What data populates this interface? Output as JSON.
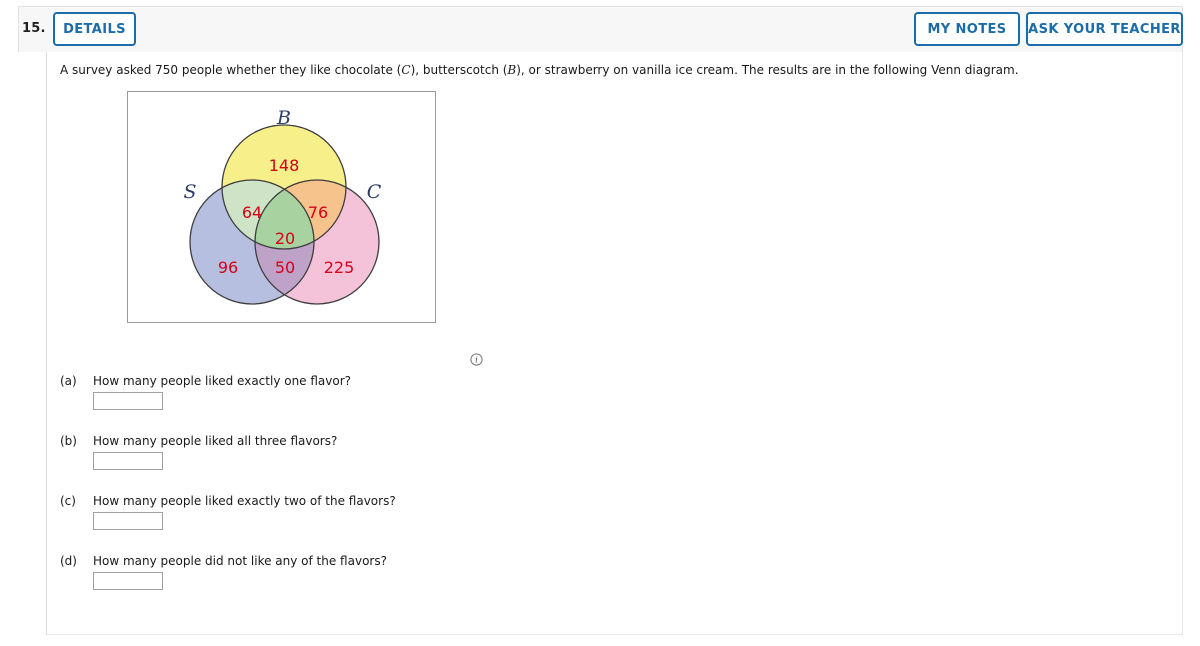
{
  "header": {
    "question_number": "15.",
    "details_label": "DETAILS",
    "my_notes_label": "MY NOTES",
    "ask_teacher_label": "ASK YOUR TEACHER",
    "accent_color": "#1b6ca8",
    "bar_background": "#f7f7f7"
  },
  "prompt": {
    "text_part_1": "A survey asked 750 people whether they like chocolate (",
    "var_c": "C",
    "text_part_2": "), butterscotch (",
    "var_b": "B",
    "text_part_3": "), or strawberry on vanilla ice cream. The results are in the following Venn diagram.",
    "total_surveyed": "750"
  },
  "venn": {
    "set_labels": {
      "b": "B",
      "s": "S",
      "c": "C"
    },
    "label_color": "#2e3d66",
    "number_color": "#d80018",
    "outline_color": "#3d3d3d",
    "frame_color": "#9a9a9a",
    "regions": [
      {
        "name": "b-only",
        "label": "148",
        "fill": "#f7f08a"
      },
      {
        "name": "s-and-b",
        "label": "64",
        "fill": "#cfe4c6"
      },
      {
        "name": "b-and-c",
        "label": "76",
        "fill": "#f6c38d"
      },
      {
        "name": "all-three",
        "label": "20",
        "fill": "#a8d2a0"
      },
      {
        "name": "s-only",
        "label": "96",
        "fill": "#b6bfe0"
      },
      {
        "name": "s-and-c",
        "label": "50",
        "fill": "#bfa2c8"
      },
      {
        "name": "c-only",
        "label": "225",
        "fill": "#f4c3da"
      }
    ],
    "info_icon": "info-icon"
  },
  "questions": [
    {
      "letter": "(a)",
      "text": "How many people liked exactly one flavor?",
      "answer_value": "",
      "placeholder": ""
    },
    {
      "letter": "(b)",
      "text": "How many people liked all three flavors?",
      "answer_value": "",
      "placeholder": ""
    },
    {
      "letter": "(c)",
      "text": "How many people liked exactly two of the flavors?",
      "answer_value": "",
      "placeholder": ""
    },
    {
      "letter": "(d)",
      "text": "How many people did not like any of the flavors?",
      "answer_value": "",
      "placeholder": ""
    }
  ]
}
